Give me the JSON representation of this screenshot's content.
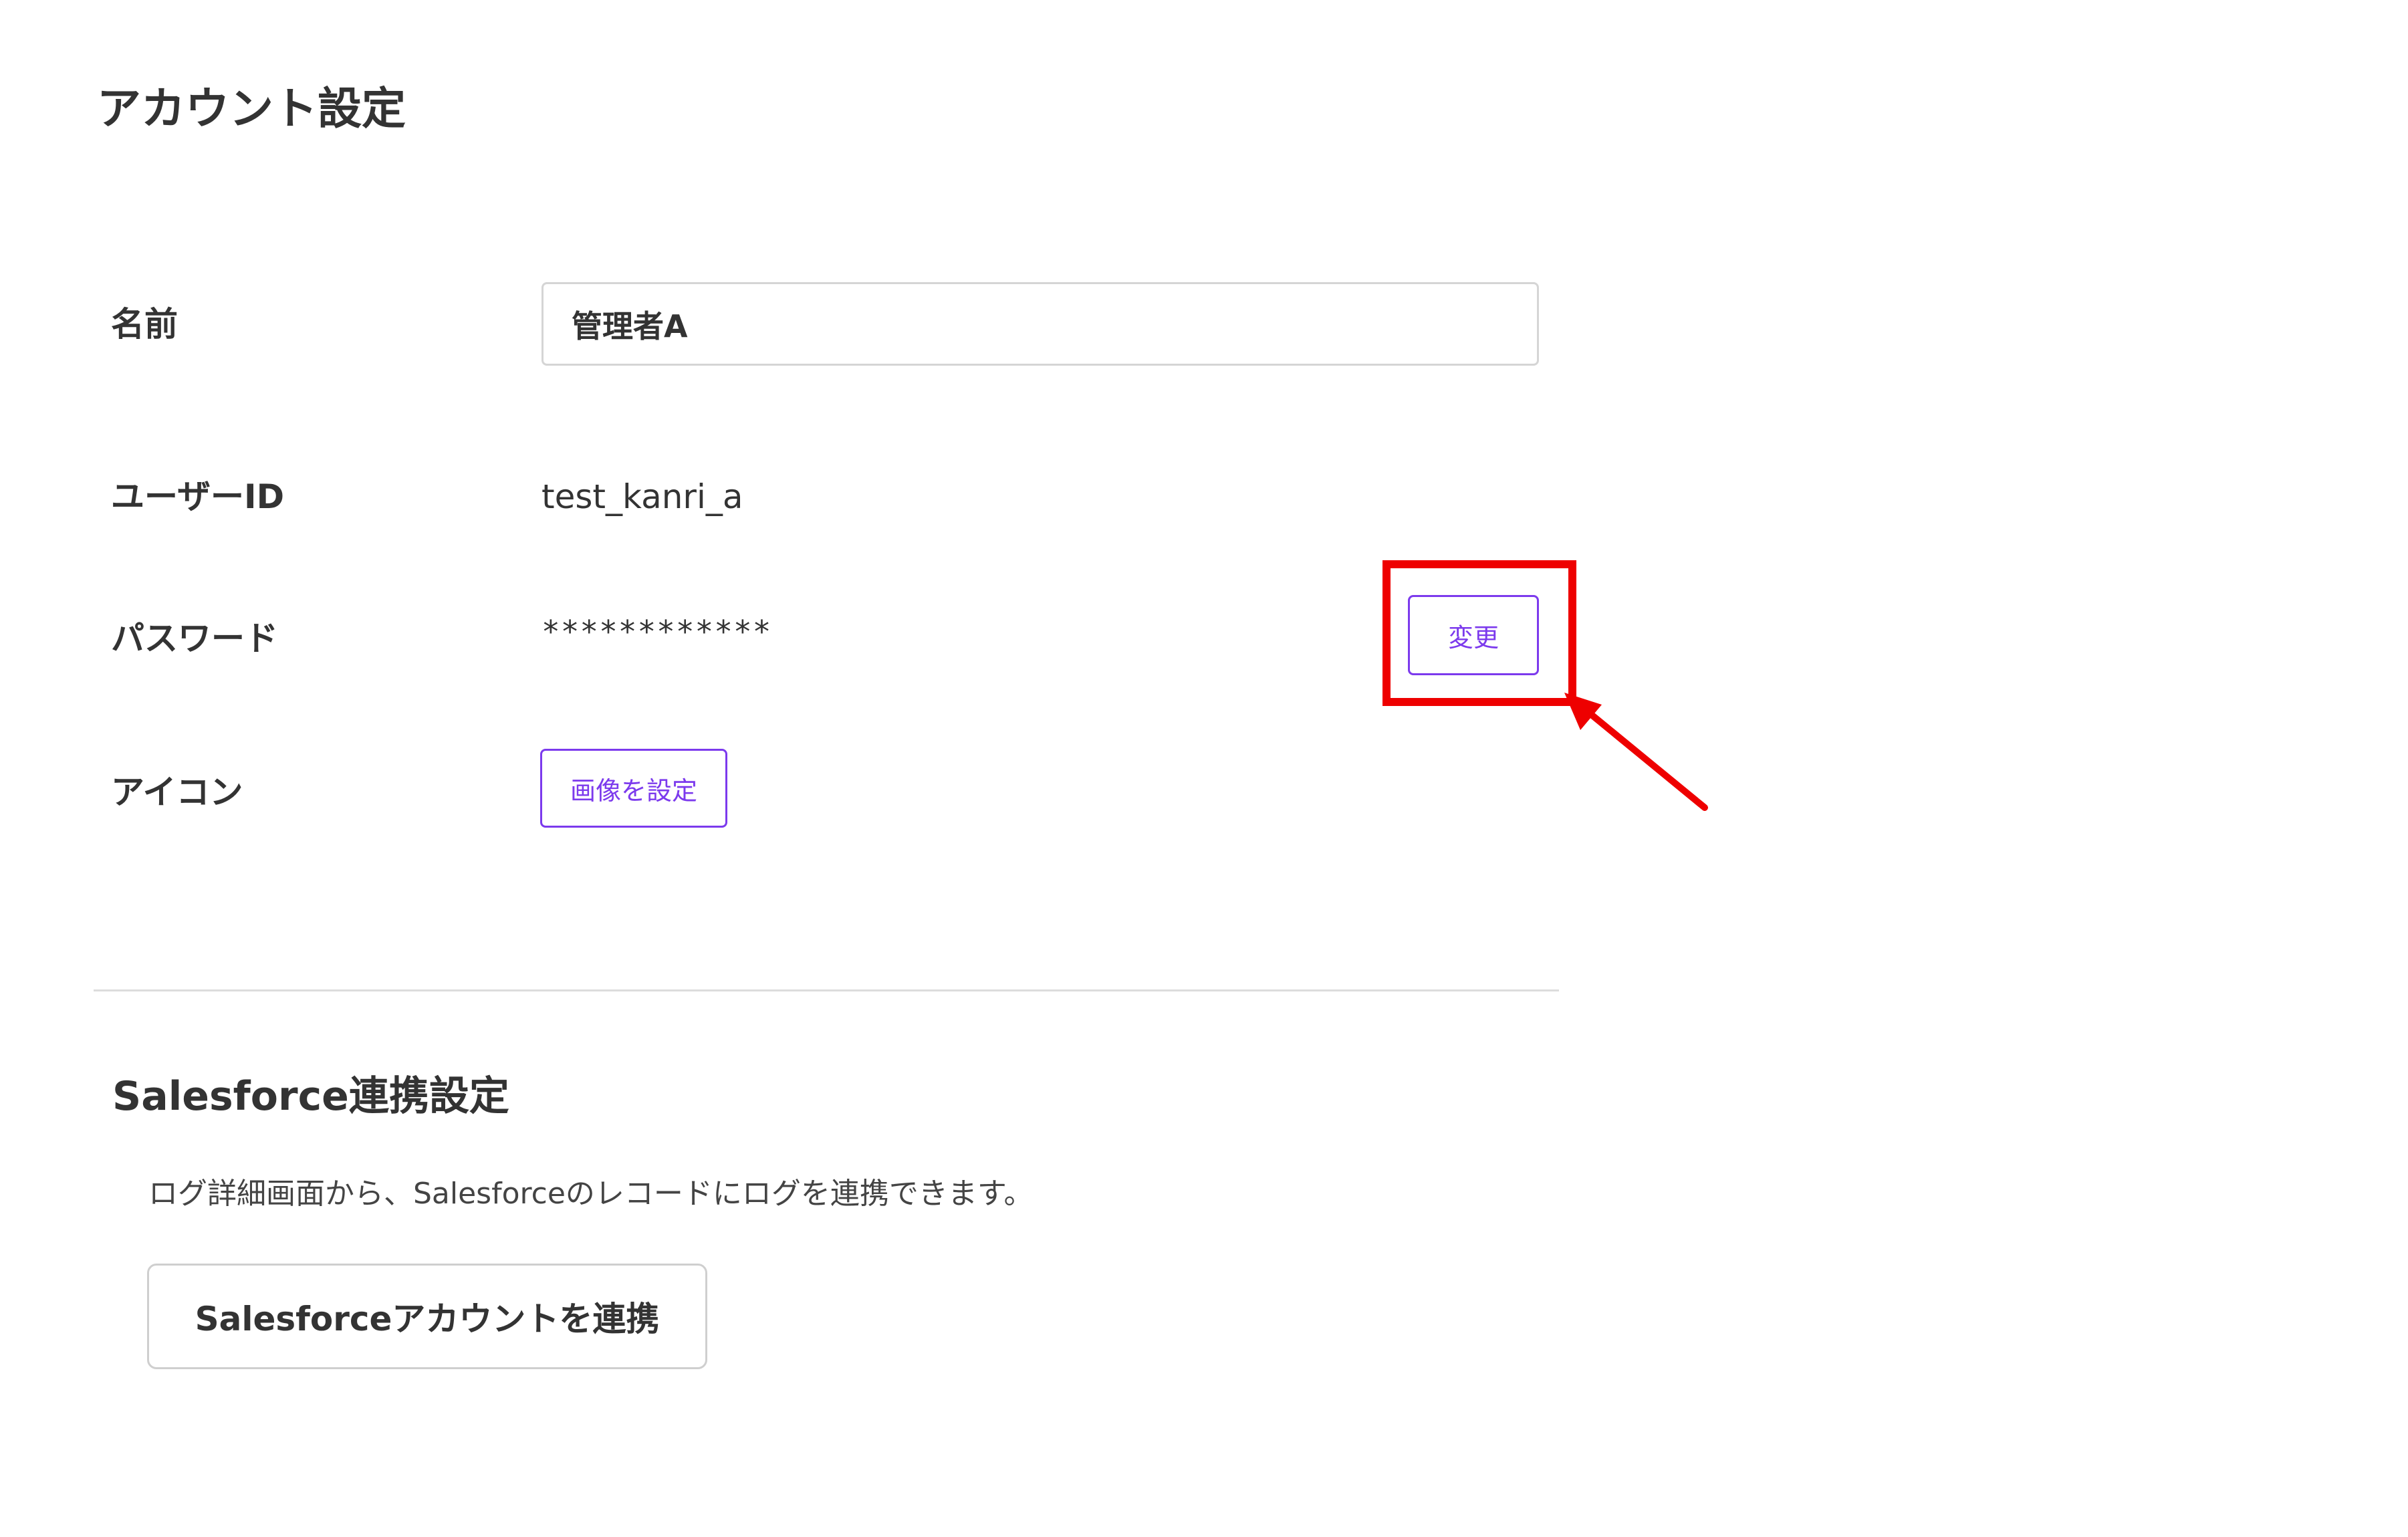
{
  "page": {
    "title": "アカウント設定"
  },
  "account": {
    "name_label": "名前",
    "name_value": "管理者A",
    "userid_label": "ユーザーID",
    "userid_value": "test_kanri_a",
    "password_label": "パスワード",
    "password_mask": "************",
    "change_button_label": "変更",
    "icon_label": "アイコン",
    "set_image_button_label": "画像を設定"
  },
  "salesforce": {
    "title": "Salesforce連携設定",
    "description": "ログ詳細画面から、Salesforceのレコードにログを連携できます。",
    "connect_button_label": "Salesforceアカウントを連携"
  },
  "colors": {
    "accent": "#7c3aed",
    "annotation": "#ee0000"
  },
  "icons": {
    "annotation_arrow": "arrow-icon"
  }
}
